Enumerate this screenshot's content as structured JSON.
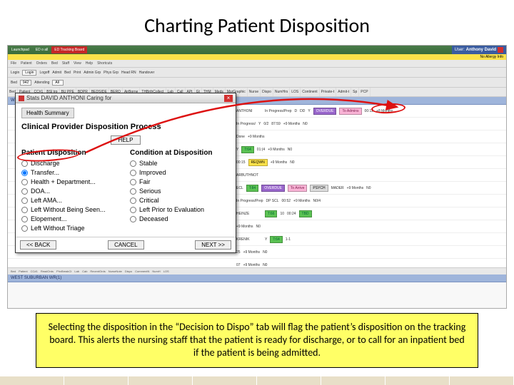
{
  "slide": {
    "title": "Charting Patient Disposition"
  },
  "titlebar": {
    "tabs": [
      "Launchpad",
      "ED o all",
      "ED Tracking Board"
    ],
    "user_label": "User:",
    "user_name": "Anthony David"
  },
  "allergy": {
    "text": "No Allergy Info"
  },
  "menubar": {
    "items": [
      "File",
      "Patient",
      "Orders",
      "Bed",
      "Staff",
      "View",
      "Help",
      "Shortcuts"
    ]
  },
  "toolbar": {
    "items": [
      {
        "lbl": "Login",
        "val": "Login"
      },
      {
        "lbl": "Logoff",
        "val": ""
      },
      {
        "lbl": "Admit",
        "val": ""
      },
      {
        "lbl": "Bed",
        "val": ""
      },
      {
        "lbl": "Print",
        "val": ""
      },
      {
        "lbl": "Admin Grp",
        "val": ""
      },
      {
        "lbl": "Phys Grp",
        "val": ""
      },
      {
        "lbl": "Head RN",
        "val": ""
      },
      {
        "lbl": "Handover",
        "val": ""
      }
    ],
    "row2": {
      "bed": "Bed",
      "bed_val": "942",
      "attending": "Attending",
      "attending_val": "All"
    }
  },
  "colheads": [
    "Bed",
    "Patient",
    "CC#1",
    "BSI trp",
    "BU PPE",
    "BDPR",
    "BEDSIDE",
    "BERQ",
    "AirBorne",
    "THBrthCollect",
    "Lab",
    "Call",
    "APt",
    "Gt",
    "THM",
    "Meds",
    "MsrGraphic",
    "Nurse",
    "Dispo",
    "NumHrs",
    "LOS",
    "Continent",
    "Private-t",
    "Admit-t",
    "Sp",
    "PCP"
  ],
  "boards": {
    "primary": "WEST SUBURBAN PATS(16)",
    "secondary": "WEST SUBURBAN WR(1)"
  },
  "rows": [
    {
      "name": "ANTHONI",
      "status": "In Progress/Prep",
      "d": "D",
      "dd": "DD",
      "y": "Y",
      "mark": "OVERDUE",
      "flag": "To Admins",
      "flagColor": "pink",
      "hrs": "00:12",
      "months": "+8 Months"
    },
    {
      "name": "",
      "status": "In Progress/ ",
      "d": "Y",
      "dd": "0/2",
      "y": "",
      "mark": "",
      "flag": "",
      "flagColor": "",
      "hrs": "87:59",
      "months": "+9 Months",
      "ng": "N0"
    },
    {
      "name": "",
      "status": "",
      "d": "",
      "dd": "Done",
      "y": "",
      "mark": "",
      "flag": "",
      "flagColor": "",
      "hrs": "",
      "months": "+9 Months",
      "ng": ""
    },
    {
      "name": "",
      "status": "",
      "d": "",
      "dd": "",
      "y": "Y",
      "mark": "",
      "flag": "",
      "flagColor": "green",
      "flagText": "T:64",
      "hrs": "01:(4",
      "months": "+9 Months",
      "ng": "N0"
    },
    {
      "name": "",
      "status": "",
      "d": "",
      "dd": "",
      "y": "",
      "mark": "",
      "flag": "",
      "flagColor": "",
      "hrs": "00:15",
      "fl2": "REQWN",
      "months": "+9 Months",
      "ng": "N0"
    },
    {
      "name": "ARBUTHNOT",
      "status": "",
      "d": "",
      "dd": "",
      "y": "",
      "mark": "",
      "flag": "",
      "flagColor": "",
      "hrs": "",
      "months": "",
      "ng": ""
    },
    {
      "name": "",
      "status": "",
      "d": "ECL",
      "dd": "",
      "y": "",
      "mark": "",
      "flag": "T:84",
      "flagColor": "green",
      "hrs": "",
      "ovr": "OVERDUE",
      "ovr2": "To Arrive",
      "ovr2Color": "pink",
      "psych": "PSYCH",
      "m": "MADER",
      "months": "+9 Months",
      "ng": "N0"
    },
    {
      "name": "",
      "status": "In Progress/Prep",
      "d": "DP SCL",
      "dd": "",
      "y": "",
      "mark": "",
      "flag": "",
      "flagColor": "",
      "hrs": "00:52",
      "months": "+9 Months",
      "ng": "N0/4"
    },
    {
      "name": "HEINZE",
      "status": "",
      "d": "",
      "dd": "",
      "y": "",
      "mark": "",
      "flag": "T:66",
      "flagColor": "green",
      "hrs": "00:24",
      "m": "10",
      "months": "",
      "ng": "",
      "tbd": "TBD",
      "tbdColor": "green"
    },
    {
      "name": "",
      "status": "",
      "d": "",
      "dd": "",
      "y": "",
      "mark": "",
      "flag": "",
      "flagColor": "",
      "hrs": "",
      "months": "+9 Months",
      "ng": "N0"
    },
    {
      "name": "KRENIK",
      "status": "",
      "d": "",
      "dd": "",
      "y": "Y",
      "mark": "",
      "flag": "T:64",
      "flagColor": "green",
      "hrs": "1-1",
      "months": "",
      "ng": ""
    },
    {
      "name": "",
      "status": "",
      "d": "",
      "dd": "",
      "y": "",
      "mark": "",
      "flag": "",
      "flagColor": "",
      "hrs": "25",
      "months": "+9 Months",
      "ng": "N0"
    },
    {
      "name": "",
      "status": "",
      "d": "",
      "dd": "",
      "y": "",
      "mark": "",
      "flag": "",
      "flagColor": "",
      "hrs": "07",
      "months": "+9 Months",
      "ng": "N0"
    }
  ],
  "dialog": {
    "title_prefix": "Stats DAVID ANTHONI Caring for",
    "health_summary": "Health Summary",
    "heading": "Clinical Provider Disposition Process",
    "help": "HELP",
    "left_head": "Patient Disposition",
    "right_head": "Condition at Disposition",
    "left_opts": [
      "Discharge",
      "Transfer...",
      "Health + Department...",
      "DOA...",
      "Left AMA...",
      "Left Without Being Seen...",
      "Elopement...",
      "Left Without Triage"
    ],
    "right_opts": [
      "Stable",
      "Improved",
      "Fair",
      "Serious",
      "Critical",
      "Left Prior to Evaluation",
      "Deceased"
    ],
    "back": "<< BACK",
    "cancel": "CANCEL",
    "next": "NEXT >>"
  },
  "caption": {
    "text": "Selecting the disposition in the “Decision to Dispo” tab will flag the patient’s disposition on the tracking board. This alerts the nursing staff that the patient is ready for discharge, or to call for an inpatient bed if the patient is being admitted."
  },
  "footer_cols": [
    "Bed",
    "Patient",
    "CC#1",
    "ReadOrds",
    "PhxBreakCt",
    "Lab",
    "Cab",
    "RecentOrds",
    "NurseNote",
    "Dispo",
    "CommentN",
    "NumH",
    "LOS"
  ]
}
